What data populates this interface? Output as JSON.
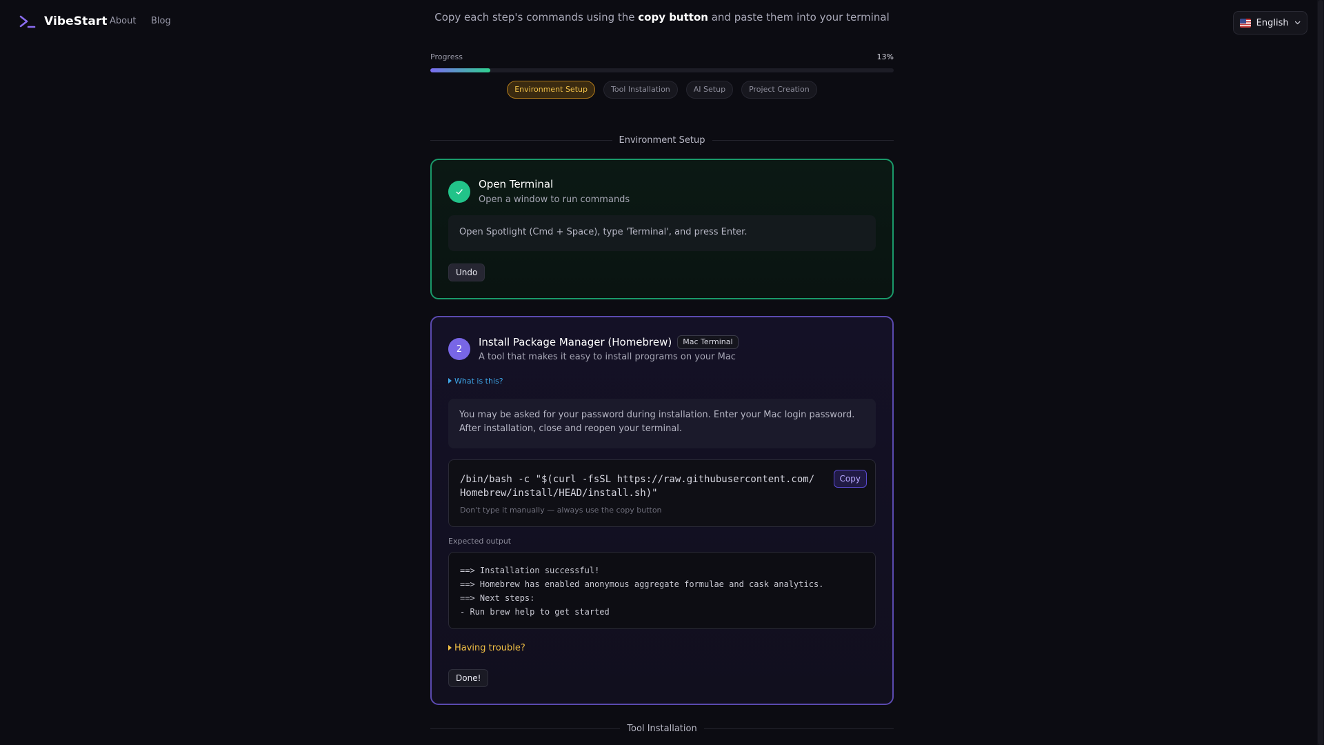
{
  "header": {
    "brand": "VibeStart",
    "nav": [
      "About",
      "Blog"
    ],
    "language": "English",
    "subtitle_pre": "Copy each step's commands using the ",
    "subtitle_bold": "copy button",
    "subtitle_post": " and paste them into your terminal"
  },
  "progress": {
    "label": "Progress",
    "percent_text": "13%",
    "value": 0.13
  },
  "phases": [
    {
      "label": "Environment Setup",
      "active": true
    },
    {
      "label": "Tool Installation",
      "active": false
    },
    {
      "label": "AI Setup",
      "active": false
    },
    {
      "label": "Project Creation",
      "active": false
    }
  ],
  "sections": {
    "environment": "Environment Setup",
    "tools": "Tool Installation"
  },
  "step1": {
    "status_icon": "check-icon",
    "title": "Open Terminal",
    "description": "Open a window to run commands",
    "instruction": "Open Spotlight (Cmd + Space), type 'Terminal', and press Enter.",
    "button": "Undo"
  },
  "step2": {
    "number": "2",
    "title": "Install Package Manager (Homebrew)",
    "badge": "Mac Terminal",
    "description": "A tool that makes it easy to install programs on your Mac",
    "what_is_this": "What is this?",
    "note": "You may be asked for your password during installation. Enter your Mac login password. After installation, close and reopen your terminal.",
    "command": "/bin/bash -c \"$(curl -fsSL https://raw.githubusercontent.com/Homebrew/install/HEAD/install.sh)\"",
    "command_hint": "Don't type it manually — always use the copy button",
    "copy_label": "Copy",
    "expected_label": "Expected output",
    "output": [
      "==> Installation successful!",
      "==> Homebrew has enabled anonymous aggregate formulae and cask analytics.",
      "==> Next steps:",
      "- Run brew help to get started"
    ],
    "trouble": "Having trouble?",
    "done": "Done!"
  },
  "colors": {
    "accent_purple": "#7866e6",
    "success_green": "#22c389",
    "active_phase": "#f3c34b",
    "link_blue": "#3ea5e6"
  }
}
